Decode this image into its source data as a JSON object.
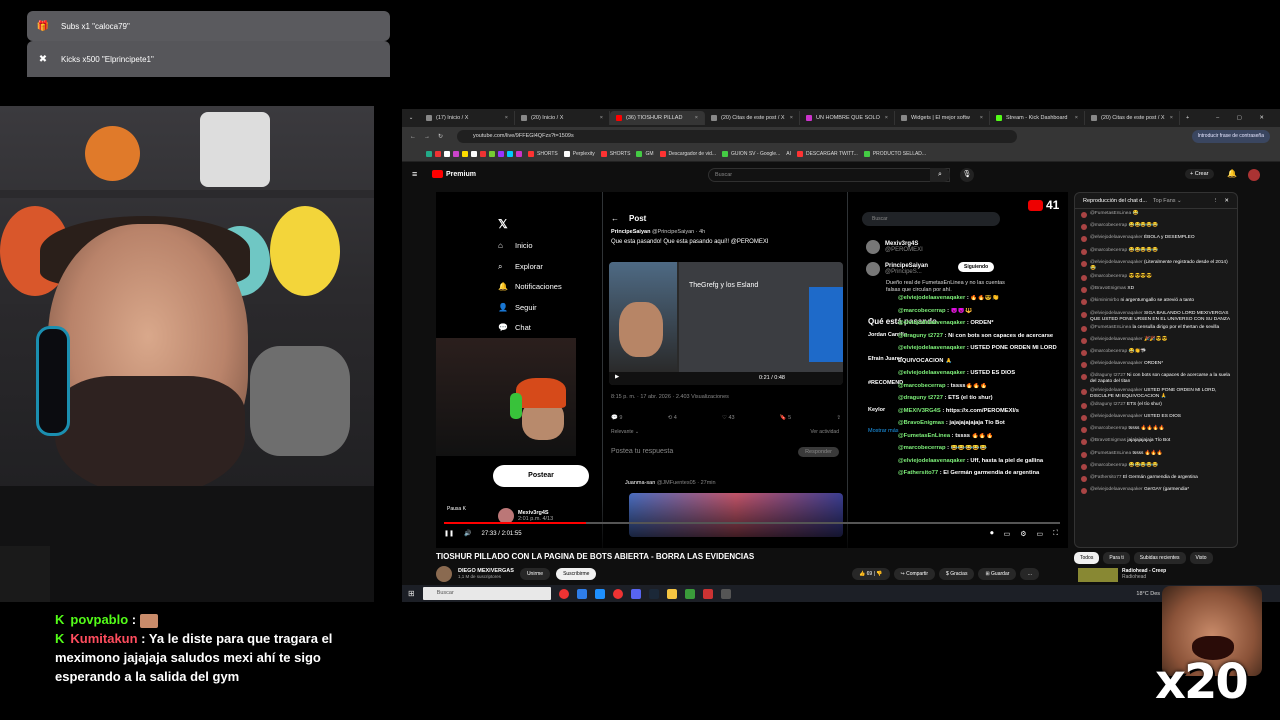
{
  "alerts": [
    {
      "icon": "gift-icon",
      "text": "Subs x1 \"caloca79\""
    },
    {
      "icon": "kick-coin-icon",
      "text": "Kicks x500 \"Elprincipete1\""
    }
  ],
  "browser": {
    "tabs": [
      {
        "label": "(17) Inicio / X",
        "active": false
      },
      {
        "label": "(20) Inicio / X",
        "active": false
      },
      {
        "label": "(36) TIOSHUR PILLAD",
        "active": true
      },
      {
        "label": "(20) Citas de este post / X",
        "active": false
      },
      {
        "label": "UN HOMBRE QUE SOLO",
        "active": false
      },
      {
        "label": "Widgets | El mejor softw",
        "active": false
      },
      {
        "label": "Stream - Kick Dashboard",
        "active": false
      },
      {
        "label": "(20) Citas de este post / X",
        "active": false
      }
    ],
    "url": "youtube.com/live/9FFEGl4QFzs?t=1509s",
    "password_button": "Introducir frase de contraseña",
    "bookmarks": [
      "SHORTS",
      "Perplexity",
      "SHORTS",
      "GM",
      "Descargador de vid...",
      "GUION SV - Google...",
      "AI",
      "DESCARGAR TWITT...",
      "PRODUCTO SELLAD..."
    ]
  },
  "youtube": {
    "logo": "Premium",
    "search_placeholder": "Buscar",
    "create": "Crear",
    "notif_count": "9+",
    "sub_count_overlay": "41",
    "video_title": "TIOSHUR PILLADO CON LA PAGINA DE BOTS ABIERTA - BORRA LAS EVIDENCIAS",
    "channel": "DIEGO MEXIVERGAS",
    "subscribers": "1,1 M de suscriptores",
    "join": "Unirme",
    "subscribe": "Suscribirme",
    "likes": "69",
    "share": "Compartir",
    "thanks": "Gracias",
    "save": "Guardar",
    "time": "27:33 / 2:01:55",
    "pause_label": "Pausa",
    "pause_key": "K",
    "progress": 0.23,
    "filters": [
      "Todos",
      "Para ti",
      "Subidas recientes",
      "Visto"
    ],
    "next_video": {
      "title": "Radiohead - Creep",
      "channel": "Radiohead"
    }
  },
  "x_ui": {
    "nav": [
      "Inicio",
      "Explorar",
      "Notificaciones",
      "Seguir",
      "Chat"
    ],
    "post_button": "Postear",
    "post_header": "Post",
    "post_author": "PrincipeSaiyan",
    "post_handle": "@PrincipeSaiyan · 4h",
    "post_text": "Que esta pasando! Que esta pasando aquí!! @PEROMEXI",
    "post_meta": "8:15 p. m. · 17 abr. 2026 · 2.403 Visualizaciones",
    "post_stats": [
      "9",
      "4",
      "43",
      "5"
    ],
    "relevant": "Relevante",
    "view_activity": "Ver actividad",
    "reply_placeholder": "Postea tu respuesta",
    "reply_button": "Responder",
    "reply_author": "Juanma-san",
    "reply_handle": "@JMFuentes05 · 27min",
    "video_time": "0:21 / 0:48",
    "media_title": "TheGrefg y los Esland",
    "search": "Buscar",
    "user1_name": "Mexiv3rg4S",
    "user1_handle": "@PEROMEXI",
    "user2_name": "PrincipeSaiyan",
    "user2_handle": "@PrincipeS...",
    "follow": "Siguiendo",
    "bio": "Dueño real de FumetasEnLinea y no las cuentas falsas que circulan por ahí.",
    "whats_happening": "Qué está pasando",
    "trends": [
      "Jordan Carrillo",
      "Efrain Juarez",
      "#RECOMEND",
      "Keylor",
      "Mostrar más"
    ],
    "streamer_name": "Mexiv3rg4S",
    "streamer_time": "2:01 p.m. 4/13"
  },
  "overlay_chat": [
    {
      "user": "@elviejodelaavenaqaker",
      "text": ": 🔥🔥😎👏"
    },
    {
      "user": "@marcobecerrap",
      "text": ": 😈😈🔱"
    },
    {
      "user": "@elviejodelaavenaqaker",
      "text": ": ORDEN*"
    },
    {
      "user": "@draguny t2727",
      "text": ": Ni con bots son capaces de acercarse"
    },
    {
      "user": "@elviejodelaavenaqaker",
      "text": ": USTED PONE ORDEN MI LORD"
    },
    {
      "user": "",
      "text": "EQUIVOCACION 🙏"
    },
    {
      "user": "@elviejodelaavenaqaker",
      "text": ": USTED ES DIOS"
    },
    {
      "user": "@marcobecerrap",
      "text": ": tssss🔥🔥🔥"
    },
    {
      "user": "@draguny t2727",
      "text": ": ETS (el tío shur)"
    },
    {
      "user": "@MEXIV3RG4S",
      "text": ": https://x.com/PEROMEXI/s"
    },
    {
      "user": "@BravoEnigmas",
      "text": ": jajajajajajaja Tío Bot"
    },
    {
      "user": "@FumetasEnLinea",
      "text": ": tssss 🔥🔥🔥"
    },
    {
      "user": "@marcobecerrap",
      "text": ": 😂😂😂😂😂"
    },
    {
      "user": "@elviejodelaavenaqaker",
      "text": ": Uff, hasta la piel de gallina"
    },
    {
      "user": "@Fathersito77",
      "text": ": El Germán garmendia de argentina"
    }
  ],
  "yt_chat": {
    "header": "Reproducción del chat d...",
    "mode": "Top Fans",
    "messages": [
      {
        "user": "@FumetasEnLinea",
        "text": "😂"
      },
      {
        "user": "@marcobecerrap",
        "text": "😂😂😂😂😂"
      },
      {
        "user": "@elviejodelaavenaqaker",
        "text": "ÉBOLA y DESEMPLEO"
      },
      {
        "user": "@marcobecerrap",
        "text": "😂😂😂😂😂"
      },
      {
        "user": "@elviejodelaavenaqaker",
        "text": "(Literalmente registrado desde el 2014) 😂"
      },
      {
        "user": "@marcobecerrap",
        "text": "😎😎😎😎"
      },
      {
        "user": "@BravoEnigmas",
        "text": "XD"
      },
      {
        "user": "@kiminimirbo",
        "text": "ni argentumgallo se atrevió a tanto"
      },
      {
        "user": "@elviejodelaavenaqaker",
        "text": "SIGA BAILANDO LORD MEXIVERGAS QUE USTED PONE URSEN EN EL UNIVERSO CON SU DANZA"
      },
      {
        "user": "@FumetasEnLinea",
        "text": "la censulla dirigo por el thertan de sevilla"
      },
      {
        "user": "@elviejodelaavenaqaker",
        "text": "🎉🎉😎😎"
      },
      {
        "user": "@marcobecerrap",
        "text": "😂👏🦈"
      },
      {
        "user": "@elviejodelaavenaqaker",
        "text": "ORDEN*"
      },
      {
        "user": "@draguny t2727",
        "text": "Ni con bots son capaces de acercarse a la suela del zapato del titan"
      },
      {
        "user": "@elviejodelaavenaqaker",
        "text": "USTED PONE ORDEN MI LORD, DISCULPE MI EQUIVOCACION 🙏"
      },
      {
        "user": "@draguny t2727",
        "text": "ETS (el tío shur)"
      },
      {
        "user": "@elviejodelaavenaqaker",
        "text": "USTED ES DIOS"
      },
      {
        "user": "@marcobecerrap",
        "text": "tssss 🔥🔥🔥🔥"
      },
      {
        "user": "@BravoEnigmas",
        "text": "jajajajajajaja Tío Bot"
      },
      {
        "user": "@FumetasEnLinea",
        "text": "tssss 🔥🔥🔥"
      },
      {
        "user": "@marcobecerrap",
        "text": "😂😂😂😂😂"
      },
      {
        "user": "@Fathersito77",
        "text": "El Germán garmendia de argentina"
      },
      {
        "user": "@elviejodelaavenaqaker",
        "text": "GerGAY (garmendia*"
      }
    ]
  },
  "taskbar": {
    "search": "Buscar",
    "weather": "18°C",
    "weather_extra": "Des"
  },
  "stream_chat": [
    {
      "user": "povpablo",
      "text": ""
    },
    {
      "user": "Kumitakun",
      "text": "Ya le diste para que tragara el meximono jajajaja saludos mexi ahí te sigo esperando a la salida del gym"
    }
  ],
  "emote_counter": "x20",
  "colors": {
    "kick_green": "#53fc18",
    "yt_red": "#ff0000",
    "overlay_name": "#7ef07a"
  }
}
